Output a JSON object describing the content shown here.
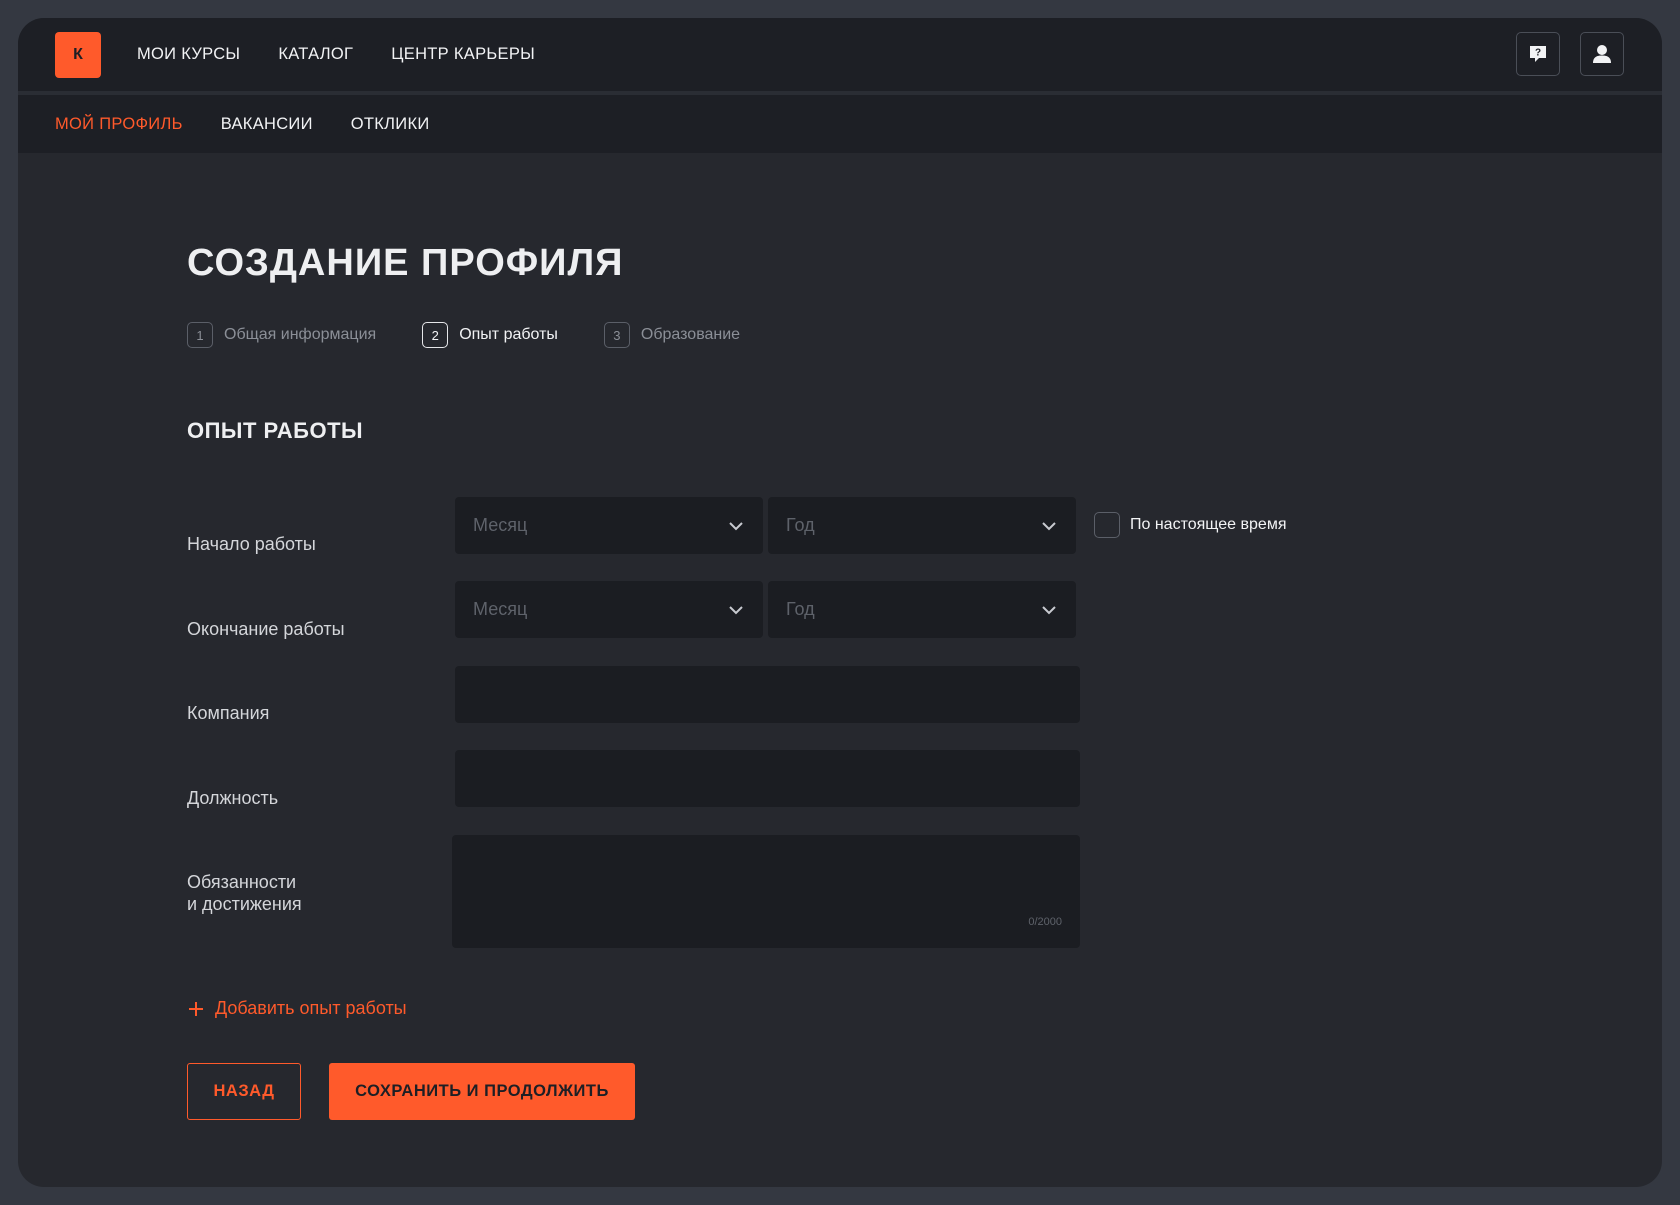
{
  "header": {
    "logo_letter": "К",
    "nav": [
      "МОИ КУРСЫ",
      "КАТАЛОГ",
      "ЦЕНТР КАРЬЕРЫ"
    ],
    "icons": [
      "help-chat-icon",
      "user-icon"
    ]
  },
  "subnav": {
    "items": [
      {
        "label": "МОЙ ПРОФИЛЬ",
        "active": true
      },
      {
        "label": "ВАКАНСИИ",
        "active": false
      },
      {
        "label": "ОТКЛИКИ",
        "active": false
      }
    ]
  },
  "page": {
    "title": "СОЗДАНИЕ ПРОФИЛЯ",
    "steps": [
      {
        "num": "1",
        "label": "Общая информация",
        "active": false
      },
      {
        "num": "2",
        "label": "Опыт работы",
        "active": true
      },
      {
        "num": "3",
        "label": "Образование",
        "active": false
      }
    ],
    "section_title": "ОПЫТ РАБОТЫ"
  },
  "form": {
    "start_label": "Начало работы",
    "end_label": "Окончание работы",
    "month_placeholder": "Месяц",
    "year_placeholder": "Год",
    "current_label": "По настоящее время",
    "current_checked": false,
    "company_label": "Компания",
    "company_value": "",
    "position_label": "Должность",
    "position_value": "",
    "duties_label_line1": "Обязанности",
    "duties_label_line2": "и достижения",
    "duties_value": "",
    "duties_counter": "0/2000",
    "add_experience": "Добавить опыт работы"
  },
  "actions": {
    "back": "НАЗАД",
    "save": "СОХРАНИТЬ И ПРОДОЛЖИТЬ"
  },
  "colors": {
    "accent": "#ff5a2b",
    "background": "#26282e",
    "panel": "#1d1f25",
    "field": "#1b1d22"
  }
}
